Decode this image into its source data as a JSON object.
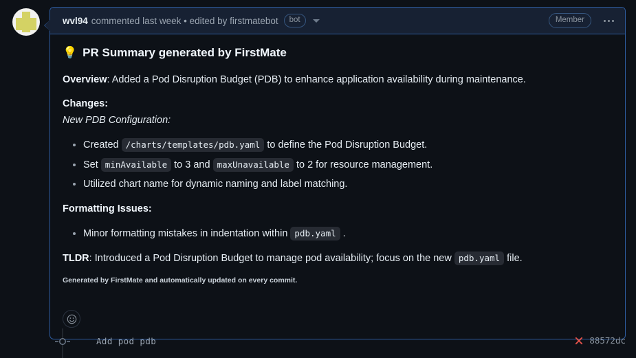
{
  "colors": {
    "page_bg": "#0d1117",
    "header_bg": "#172133",
    "accent_border": "#2d5b9e",
    "code_bg": "#272b33",
    "text": "#e6edf3",
    "muted": "#8b949e",
    "fail_red": "#e5534b",
    "avatar_shape": "#d4d264"
  },
  "avatar": {
    "name": "wvl94-avatar"
  },
  "comment": {
    "header": {
      "author": "wvl94",
      "meta": "commented last week • edited by firstmatebot",
      "bot_badge": "bot",
      "caret_icon": "chevron-down-icon",
      "member_badge": "Member",
      "kebab_icon": "kebab-horizontal-icon"
    },
    "body": {
      "emoji": "💡",
      "title": "PR Summary generated by FirstMate",
      "overview_label": "Overview",
      "overview_sep": ": ",
      "overview_text": "Added a Pod Disruption Budget (PDB) to enhance application availability during maintenance.",
      "changes_label": "Changes:",
      "changes_subtitle": "New PDB Configuration:",
      "changes_items": [
        {
          "pre": "Created ",
          "code": "/charts/templates/pdb.yaml",
          "mid": " to define the Pod Disruption Budget.",
          "code2": "",
          "post": ""
        },
        {
          "pre": "Set ",
          "code": "minAvailable",
          "mid": " to 3 and ",
          "code2": "maxUnavailable",
          "post": " to 2 for resource management."
        },
        {
          "pre": "Utilized chart name for dynamic naming and label matching.",
          "code": "",
          "mid": "",
          "code2": "",
          "post": ""
        }
      ],
      "formatting_label": "Formatting Issues:",
      "formatting_items": [
        {
          "pre": "Minor formatting mistakes in indentation within ",
          "code": "pdb.yaml",
          "mid": " .",
          "code2": "",
          "post": ""
        }
      ],
      "tldr_label": "TLDR",
      "tldr_sep": ": ",
      "tldr_pre": "Introduced a Pod Disruption Budget to manage pod availability; focus on the new ",
      "tldr_code": "pdb.yaml",
      "tldr_post": " file.",
      "footnote": "Generated by FirstMate and automatically updated on every commit."
    },
    "reaction": {
      "icon": "smiley-icon",
      "label": "Add reaction"
    }
  },
  "timeline": {
    "node_icon": "commit-node-icon",
    "commit_message": "Add pod pdb",
    "status_icon": "x-failure-icon",
    "commit_sha": "88572dc"
  }
}
